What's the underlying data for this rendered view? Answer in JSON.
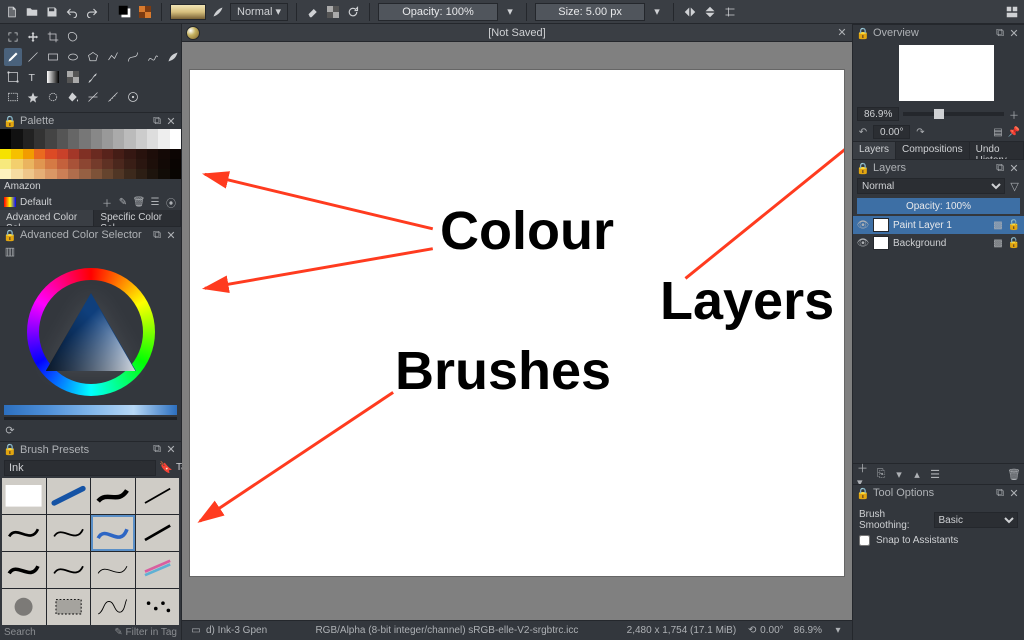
{
  "topbar": {
    "blend_mode": "Normal",
    "opacity_label": "Opacity: 100%",
    "size_label": "Size: 5.00 px"
  },
  "document": {
    "title": "[Not Saved]",
    "profile": "RGB/Alpha (8-bit integer/channel)  sRGB-elle-V2-srgbtrc.icc",
    "dimensions": "2,480 x 1,754 (17.1 MiB)",
    "angle": "0.00°",
    "zoom": "86.9%"
  },
  "canvas_annotations": {
    "colour": "Colour",
    "layers": "Layers",
    "brushes": "Brushes"
  },
  "palette": {
    "title": "Palette",
    "name": "Default",
    "category": "Amazon",
    "swatches": [
      "#000",
      "#111",
      "#222",
      "#333",
      "#444",
      "#555",
      "#666",
      "#777",
      "#888",
      "#999",
      "#aaa",
      "#bbb",
      "#ccc",
      "#ddd",
      "#eee",
      "#fff",
      "#000",
      "#111",
      "#222",
      "#333",
      "#444",
      "#555",
      "#666",
      "#777",
      "#888",
      "#999",
      "#aaa",
      "#bbb",
      "#ccc",
      "#ddd",
      "#eee",
      "#fff",
      "#f6e200",
      "#f6c000",
      "#f29c00",
      "#ea6a1f",
      "#dc4a25",
      "#c9412a",
      "#a33728",
      "#803024",
      "#6a2a20",
      "#58231b",
      "#451d16",
      "#351712",
      "#28120d",
      "#1d0d09",
      "#140906",
      "#0c0503",
      "#f7e97d",
      "#f3cf6d",
      "#eab45f",
      "#e09650",
      "#d57a44",
      "#c4613c",
      "#a85238",
      "#8c4632",
      "#743b2b",
      "#5f3124",
      "#4b271d",
      "#391e16",
      "#2a1610",
      "#1d0f0a",
      "#120906",
      "#090402",
      "#fdf2be",
      "#f6dca1",
      "#efc68a",
      "#e6af76",
      "#da9765",
      "#cb7f56",
      "#b06d4c",
      "#966043",
      "#7d5238",
      "#65442e",
      "#503625",
      "#3c291c",
      "#2c1e14",
      "#1d140d",
      "#110c07",
      "#080502"
    ]
  },
  "acs": {
    "tab_advanced": "Advanced Color Sel…",
    "tab_specific": "Specific Color Sel…",
    "title": "Advanced Color Selector"
  },
  "brushes": {
    "title": "Brush Presets",
    "search_value": "Ink",
    "tag_label": "Tag",
    "status": "d) Ink-3 Gpen",
    "foot_left": "Search",
    "foot_right": "✎ Filter in Tag"
  },
  "overview": {
    "title": "Overview",
    "zoom": "86.9%",
    "rotation": "0.00°"
  },
  "layers": {
    "tab_layers": "Layers",
    "tab_comp": "Compositions",
    "tab_undo": "Undo History",
    "title": "Layers",
    "blend_mode": "Normal",
    "opacity_label": "Opacity:  100%",
    "items": [
      {
        "name": "Paint Layer 1",
        "selected": true
      },
      {
        "name": "Background",
        "selected": false
      }
    ]
  },
  "tool_options": {
    "title": "Tool Options",
    "smoothing_label": "Brush Smoothing:",
    "smoothing_value": "Basic",
    "snap_label": "Snap to Assistants"
  }
}
